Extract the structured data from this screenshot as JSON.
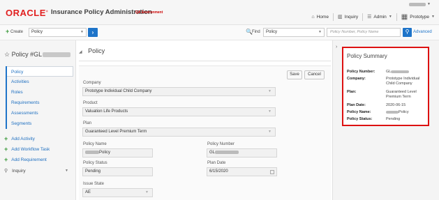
{
  "header": {
    "logo_text": "ORACLE",
    "app_title": "Insurance Policy Administration",
    "environment": "QA Environment",
    "nav": {
      "home": "Home",
      "inquiry": "Inquiry",
      "admin": "Admin",
      "prototype": "Prototype"
    }
  },
  "toolbar": {
    "create_label": "Create",
    "create_select": "Policy",
    "find_label": "Find",
    "find_select": "Policy",
    "search_placeholder": "Policy Number, Policy Name",
    "advanced_label": "Advanced"
  },
  "sidebar": {
    "title_prefix": "Policy #GL",
    "nav_items": [
      "Policy",
      "Activities",
      "Roles",
      "Requirements",
      "Assessments",
      "Segments"
    ],
    "actions": [
      "Add Activity",
      "Add Workflow Task",
      "Add Requirement"
    ],
    "inquiry_label": "Inquiry"
  },
  "main": {
    "section_title": "Policy",
    "save_label": "Save",
    "cancel_label": "Cancel",
    "fields": {
      "company_label": "Company",
      "company_value": "Prototype Individual Child Company",
      "product_label": "Product",
      "product_value": "Valuation Life Products",
      "plan_label": "Plan",
      "plan_value": "Guaranteed Level Premium Term",
      "policy_name_label": "Policy Name",
      "policy_name_suffix": "Policy",
      "policy_number_label": "Policy Number",
      "policy_number_prefix": "GL",
      "policy_status_label": "Policy Status",
      "policy_status_value": "Pending",
      "plan_date_label": "Plan Date",
      "plan_date_value": "6/15/2020",
      "issue_state_label": "Issue State",
      "issue_state_value": "AE"
    }
  },
  "summary": {
    "title": "Policy Summary",
    "policy_number_key": "Policy Number:",
    "policy_number_prefix": "GL",
    "company_key": "Company:",
    "company_value": "Prototype Individual Child Company",
    "plan_key": "Plan:",
    "plan_value": "Guaranteed Level Premium Term",
    "plan_date_key": "Plan Date:",
    "plan_date_value": "2020-06-15",
    "policy_name_key": "Policy Name:",
    "policy_name_suffix": "Policy",
    "policy_status_key": "Policy Status:",
    "policy_status_value": "Pending"
  },
  "colors": {
    "brand_red": "#e11f1f",
    "accent_blue": "#1e74c9",
    "add_green": "#3c9a3c",
    "highlight_border": "#dd1111"
  },
  "icons": [
    "home-icon",
    "inquiry-icon",
    "admin-icon",
    "prototype-icon",
    "plus-icon",
    "search-icon",
    "star-icon",
    "chevron-right-icon",
    "triangle-down-icon"
  ]
}
